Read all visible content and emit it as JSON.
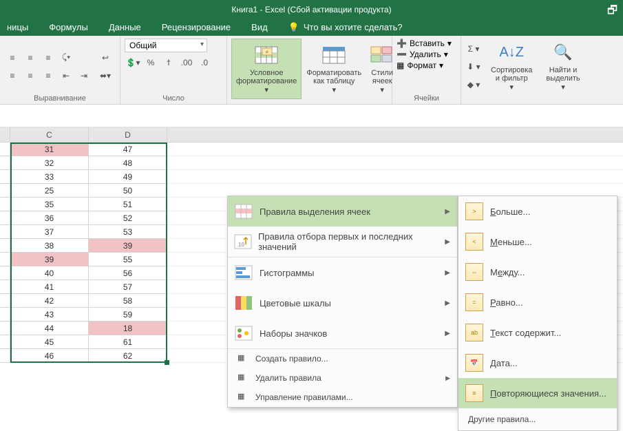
{
  "title": "Книга1 - Excel (Сбой активации продукта)",
  "menus": {
    "m0": "ницы",
    "m1": "Формулы",
    "m2": "Данные",
    "m3": "Рецензирование",
    "m4": "Вид",
    "tellme": "Что вы хотите сделать?"
  },
  "ribbon": {
    "alignment_label": "Выравнивание",
    "number_label": "Число",
    "number_format": "Общий",
    "cf": "Условное\nформатирование",
    "fmt_table": "Форматировать\nкак таблицу",
    "cell_styles": "Стили\nячеек",
    "cells_label": "Ячейки",
    "insert": "Вставить",
    "delete": "Удалить",
    "format": "Формат",
    "sort_filter": "Сортировка\nи фильтр",
    "find_select": "Найти и\nвыделить"
  },
  "cf_menu": {
    "highlight_rules": "Правила выделения ячеек",
    "top_bottom": "Правила отбора первых и последних значений",
    "data_bars": "Гистограммы",
    "color_scales": "Цветовые шкалы",
    "icon_sets": "Наборы значков",
    "new_rule": "Создать правило...",
    "clear_rules": "Удалить правила",
    "manage": "Управление правилами..."
  },
  "hr_menu": {
    "greater": "Больше...",
    "less": "Меньше...",
    "between": "Между...",
    "equal": "Равно...",
    "text_contains": "Текст содержит...",
    "date": "Дата...",
    "duplicates": "Повторяющиеся значения...",
    "more_rules": "Другие правила..."
  },
  "columns": [
    "C",
    "D"
  ],
  "rows": [
    {
      "c": 31,
      "d": 47,
      "hlc": true,
      "hld": false
    },
    {
      "c": 32,
      "d": 48,
      "hlc": false,
      "hld": false
    },
    {
      "c": 33,
      "d": 49,
      "hlc": false,
      "hld": false
    },
    {
      "c": 25,
      "d": 50,
      "hlc": false,
      "hld": false
    },
    {
      "c": 35,
      "d": 51,
      "hlc": false,
      "hld": false
    },
    {
      "c": 36,
      "d": 52,
      "hlc": false,
      "hld": false
    },
    {
      "c": 37,
      "d": 53,
      "hlc": false,
      "hld": false
    },
    {
      "c": 38,
      "d": 39,
      "hlc": false,
      "hld": true
    },
    {
      "c": 39,
      "d": 55,
      "hlc": true,
      "hld": false
    },
    {
      "c": 40,
      "d": 56,
      "hlc": false,
      "hld": false
    },
    {
      "c": 41,
      "d": 57,
      "hlc": false,
      "hld": false
    },
    {
      "c": 42,
      "d": 58,
      "hlc": false,
      "hld": false
    },
    {
      "c": 43,
      "d": 59,
      "hlc": false,
      "hld": false
    },
    {
      "c": 44,
      "d": 18,
      "hlc": false,
      "hld": true
    },
    {
      "c": 45,
      "d": 61,
      "hlc": false,
      "hld": false
    },
    {
      "c": 46,
      "d": 62,
      "hlc": false,
      "hld": false
    }
  ]
}
